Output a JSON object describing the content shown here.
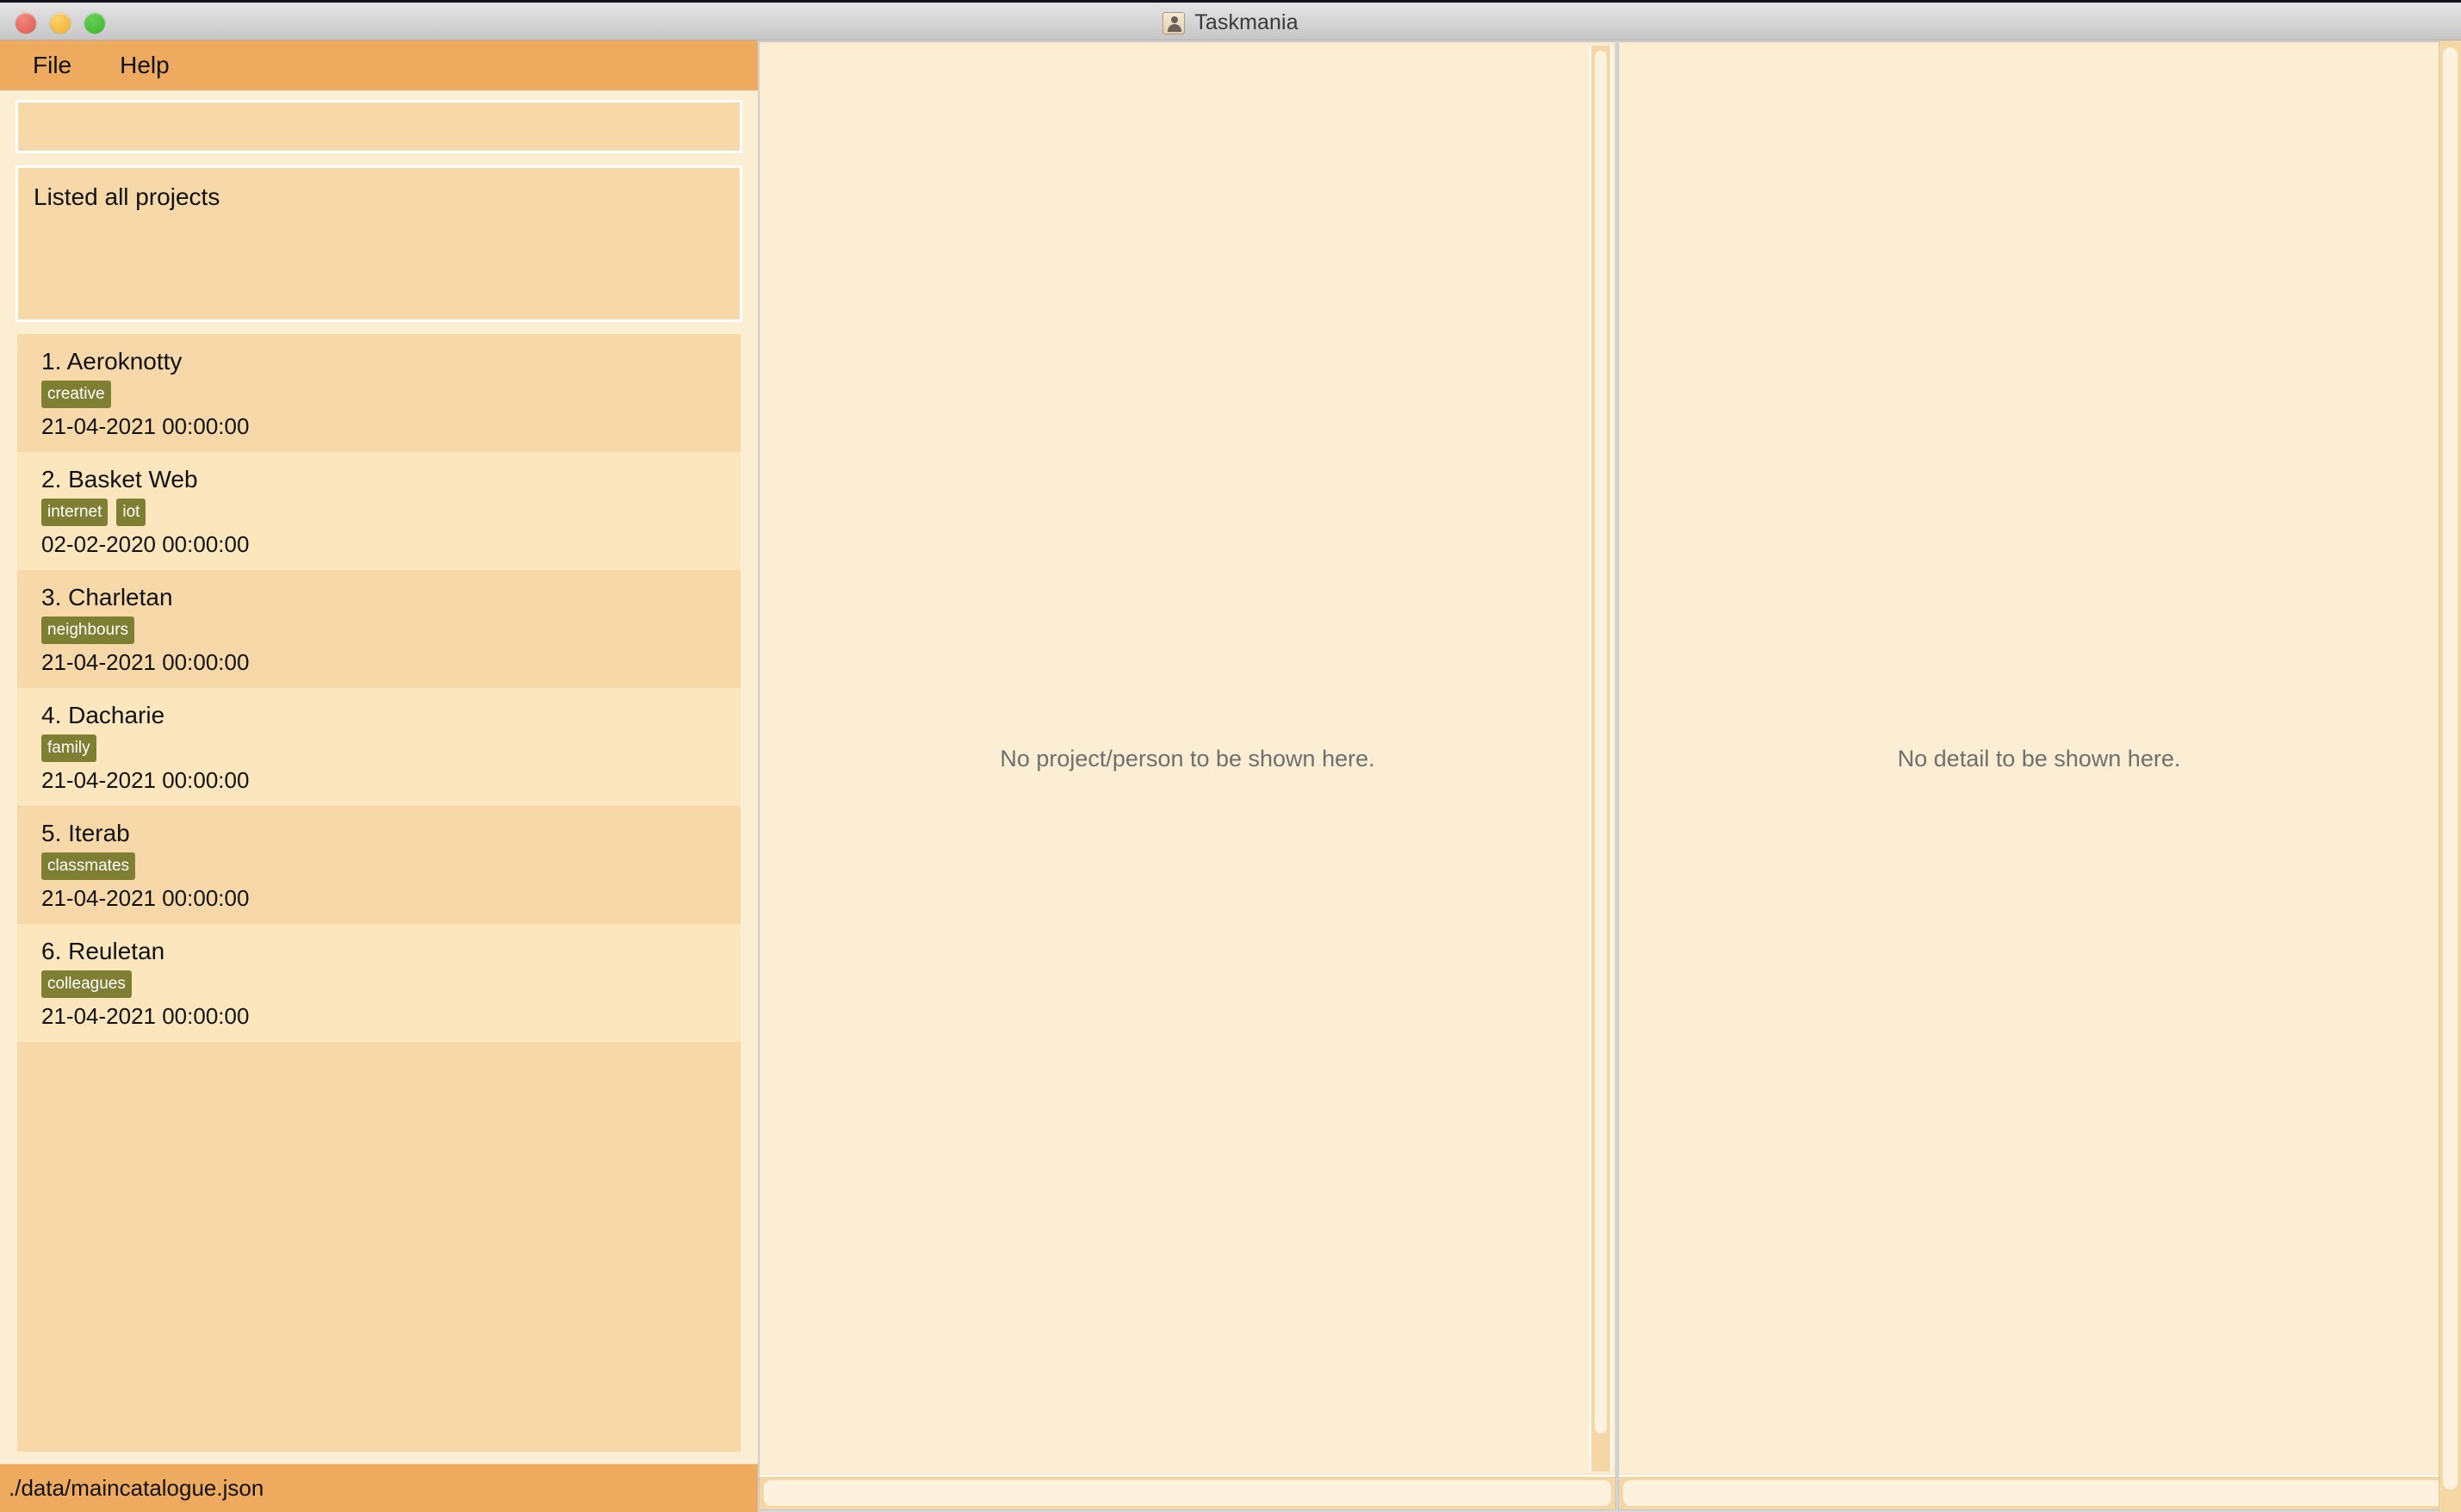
{
  "window": {
    "title": "Taskmania",
    "title_icon": "person-icon",
    "traffic_lights": [
      {
        "name": "close",
        "color": "#e0564e"
      },
      {
        "name": "minimize",
        "color": "#efb130"
      },
      {
        "name": "zoom",
        "color": "#38b629"
      }
    ]
  },
  "menubar": {
    "items": [
      {
        "label": "File"
      },
      {
        "label": "Help"
      }
    ]
  },
  "sidebar": {
    "search": {
      "value": "",
      "placeholder": ""
    },
    "status_message": "Listed all projects",
    "projects": [
      {
        "index": "1.",
        "name": "Aeroknotty",
        "tags": [
          "creative"
        ],
        "date": "21-04-2021 00:00:00",
        "shade": "alt"
      },
      {
        "index": "2.",
        "name": "Basket Web",
        "tags": [
          "internet",
          "iot"
        ],
        "date": "02-02-2020 00:00:00",
        "shade": "base"
      },
      {
        "index": "3.",
        "name": "Charletan",
        "tags": [
          "neighbours"
        ],
        "date": "21-04-2021 00:00:00",
        "shade": "alt"
      },
      {
        "index": "4.",
        "name": "Dacharie",
        "tags": [
          "family"
        ],
        "date": "21-04-2021 00:00:00",
        "shade": "base"
      },
      {
        "index": "5.",
        "name": "Iterab",
        "tags": [
          "classmates"
        ],
        "date": "21-04-2021 00:00:00",
        "shade": "alt"
      },
      {
        "index": "6.",
        "name": "Reuletan",
        "tags": [
          "colleagues"
        ],
        "date": "21-04-2021 00:00:00",
        "shade": "base"
      }
    ]
  },
  "statusbar": {
    "file_path": "./data/maincatalogue.json"
  },
  "panels": {
    "center": {
      "placeholder": "No project/person to be shown here."
    },
    "right": {
      "placeholder": "No detail to be shown here."
    }
  },
  "colors": {
    "accent": "#eeab60",
    "panel_bg": "#fbeed3",
    "row_alt": "#f6d8a9",
    "row_base": "#fbe6bd",
    "tag_bg": "#7e7f32",
    "placeholder_text": "#6f6f6f",
    "titlebar": "#d4d4d4"
  }
}
